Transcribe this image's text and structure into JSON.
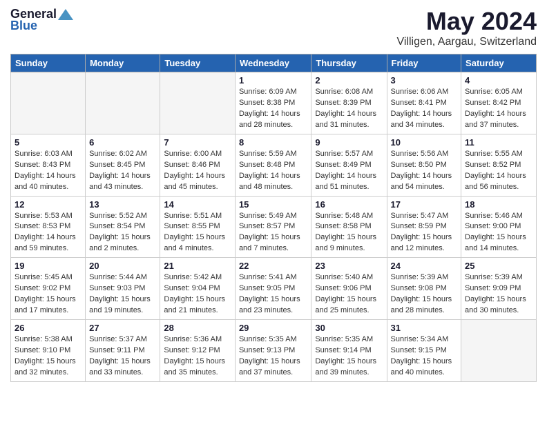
{
  "header": {
    "logo_general": "General",
    "logo_blue": "Blue",
    "title": "May 2024",
    "subtitle": "Villigen, Aargau, Switzerland"
  },
  "weekdays": [
    "Sunday",
    "Monday",
    "Tuesday",
    "Wednesday",
    "Thursday",
    "Friday",
    "Saturday"
  ],
  "weeks": [
    [
      {
        "day": "",
        "detail": ""
      },
      {
        "day": "",
        "detail": ""
      },
      {
        "day": "",
        "detail": ""
      },
      {
        "day": "1",
        "detail": "Sunrise: 6:09 AM\nSunset: 8:38 PM\nDaylight: 14 hours\nand 28 minutes."
      },
      {
        "day": "2",
        "detail": "Sunrise: 6:08 AM\nSunset: 8:39 PM\nDaylight: 14 hours\nand 31 minutes."
      },
      {
        "day": "3",
        "detail": "Sunrise: 6:06 AM\nSunset: 8:41 PM\nDaylight: 14 hours\nand 34 minutes."
      },
      {
        "day": "4",
        "detail": "Sunrise: 6:05 AM\nSunset: 8:42 PM\nDaylight: 14 hours\nand 37 minutes."
      }
    ],
    [
      {
        "day": "5",
        "detail": "Sunrise: 6:03 AM\nSunset: 8:43 PM\nDaylight: 14 hours\nand 40 minutes."
      },
      {
        "day": "6",
        "detail": "Sunrise: 6:02 AM\nSunset: 8:45 PM\nDaylight: 14 hours\nand 43 minutes."
      },
      {
        "day": "7",
        "detail": "Sunrise: 6:00 AM\nSunset: 8:46 PM\nDaylight: 14 hours\nand 45 minutes."
      },
      {
        "day": "8",
        "detail": "Sunrise: 5:59 AM\nSunset: 8:48 PM\nDaylight: 14 hours\nand 48 minutes."
      },
      {
        "day": "9",
        "detail": "Sunrise: 5:57 AM\nSunset: 8:49 PM\nDaylight: 14 hours\nand 51 minutes."
      },
      {
        "day": "10",
        "detail": "Sunrise: 5:56 AM\nSunset: 8:50 PM\nDaylight: 14 hours\nand 54 minutes."
      },
      {
        "day": "11",
        "detail": "Sunrise: 5:55 AM\nSunset: 8:52 PM\nDaylight: 14 hours\nand 56 minutes."
      }
    ],
    [
      {
        "day": "12",
        "detail": "Sunrise: 5:53 AM\nSunset: 8:53 PM\nDaylight: 14 hours\nand 59 minutes."
      },
      {
        "day": "13",
        "detail": "Sunrise: 5:52 AM\nSunset: 8:54 PM\nDaylight: 15 hours\nand 2 minutes."
      },
      {
        "day": "14",
        "detail": "Sunrise: 5:51 AM\nSunset: 8:55 PM\nDaylight: 15 hours\nand 4 minutes."
      },
      {
        "day": "15",
        "detail": "Sunrise: 5:49 AM\nSunset: 8:57 PM\nDaylight: 15 hours\nand 7 minutes."
      },
      {
        "day": "16",
        "detail": "Sunrise: 5:48 AM\nSunset: 8:58 PM\nDaylight: 15 hours\nand 9 minutes."
      },
      {
        "day": "17",
        "detail": "Sunrise: 5:47 AM\nSunset: 8:59 PM\nDaylight: 15 hours\nand 12 minutes."
      },
      {
        "day": "18",
        "detail": "Sunrise: 5:46 AM\nSunset: 9:00 PM\nDaylight: 15 hours\nand 14 minutes."
      }
    ],
    [
      {
        "day": "19",
        "detail": "Sunrise: 5:45 AM\nSunset: 9:02 PM\nDaylight: 15 hours\nand 17 minutes."
      },
      {
        "day": "20",
        "detail": "Sunrise: 5:44 AM\nSunset: 9:03 PM\nDaylight: 15 hours\nand 19 minutes."
      },
      {
        "day": "21",
        "detail": "Sunrise: 5:42 AM\nSunset: 9:04 PM\nDaylight: 15 hours\nand 21 minutes."
      },
      {
        "day": "22",
        "detail": "Sunrise: 5:41 AM\nSunset: 9:05 PM\nDaylight: 15 hours\nand 23 minutes."
      },
      {
        "day": "23",
        "detail": "Sunrise: 5:40 AM\nSunset: 9:06 PM\nDaylight: 15 hours\nand 25 minutes."
      },
      {
        "day": "24",
        "detail": "Sunrise: 5:39 AM\nSunset: 9:08 PM\nDaylight: 15 hours\nand 28 minutes."
      },
      {
        "day": "25",
        "detail": "Sunrise: 5:39 AM\nSunset: 9:09 PM\nDaylight: 15 hours\nand 30 minutes."
      }
    ],
    [
      {
        "day": "26",
        "detail": "Sunrise: 5:38 AM\nSunset: 9:10 PM\nDaylight: 15 hours\nand 32 minutes."
      },
      {
        "day": "27",
        "detail": "Sunrise: 5:37 AM\nSunset: 9:11 PM\nDaylight: 15 hours\nand 33 minutes."
      },
      {
        "day": "28",
        "detail": "Sunrise: 5:36 AM\nSunset: 9:12 PM\nDaylight: 15 hours\nand 35 minutes."
      },
      {
        "day": "29",
        "detail": "Sunrise: 5:35 AM\nSunset: 9:13 PM\nDaylight: 15 hours\nand 37 minutes."
      },
      {
        "day": "30",
        "detail": "Sunrise: 5:35 AM\nSunset: 9:14 PM\nDaylight: 15 hours\nand 39 minutes."
      },
      {
        "day": "31",
        "detail": "Sunrise: 5:34 AM\nSunset: 9:15 PM\nDaylight: 15 hours\nand 40 minutes."
      },
      {
        "day": "",
        "detail": ""
      }
    ]
  ]
}
